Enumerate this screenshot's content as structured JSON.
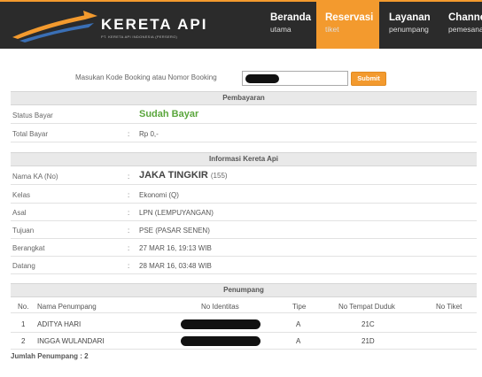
{
  "header": {
    "logo_text": "KERETA API",
    "logo_subtitle": "PT. KERETA API INDONESIA (PERSERO)",
    "nav": [
      {
        "title": "Beranda",
        "subtitle": "utama",
        "active": false
      },
      {
        "title": "Reservasi",
        "subtitle": "tiket",
        "active": true
      },
      {
        "title": "Layanan",
        "subtitle": "penumpang",
        "active": false
      },
      {
        "title": "Channel",
        "subtitle": "pemesanan",
        "active": false
      }
    ]
  },
  "booking": {
    "label": "Masukan Kode Booking atau Nomor Booking",
    "input_value": "",
    "submit_label": "Submit"
  },
  "payment": {
    "section_title": "Pembayaran",
    "status_label": "Status Bayar",
    "status_value": "Sudah Bayar",
    "total_label": "Total Bayar",
    "total_value": "Rp 0,-",
    "separator": ":"
  },
  "train": {
    "section_title": "Informasi Kereta Api",
    "name_label": "Nama KA (No)",
    "name_value": "JAKA TINGKIR",
    "number_value": "(155)",
    "class_label": "Kelas",
    "class_value": "Ekonomi (Q)",
    "origin_label": "Asal",
    "origin_value": "LPN (LEMPUYANGAN)",
    "destination_label": "Tujuan",
    "destination_value": "PSE (PASAR SENEN)",
    "depart_label": "Berangkat",
    "depart_value": "27 MAR 16, 19:13 WIB",
    "arrive_label": "Datang",
    "arrive_value": "28 MAR 16, 03:48 WIB"
  },
  "passengers": {
    "section_title": "Penumpang",
    "columns": [
      "No.",
      "Nama Penumpang",
      "No Identitas",
      "Tipe",
      "No Tempat Duduk",
      "No Tiket"
    ],
    "rows": [
      {
        "no": "1",
        "name": "ADITYA HARI",
        "identity": "",
        "type": "A",
        "seat": "21C",
        "ticket": ""
      },
      {
        "no": "2",
        "name": "INGGA WULANDARI",
        "identity": "",
        "type": "A",
        "seat": "21D",
        "ticket": ""
      }
    ],
    "total_text": "Jumlah Penumpang : 2"
  },
  "colors": {
    "accent": "#f39a2e",
    "header_bg": "#2b2b2b",
    "status_paid": "#5aa63c"
  }
}
